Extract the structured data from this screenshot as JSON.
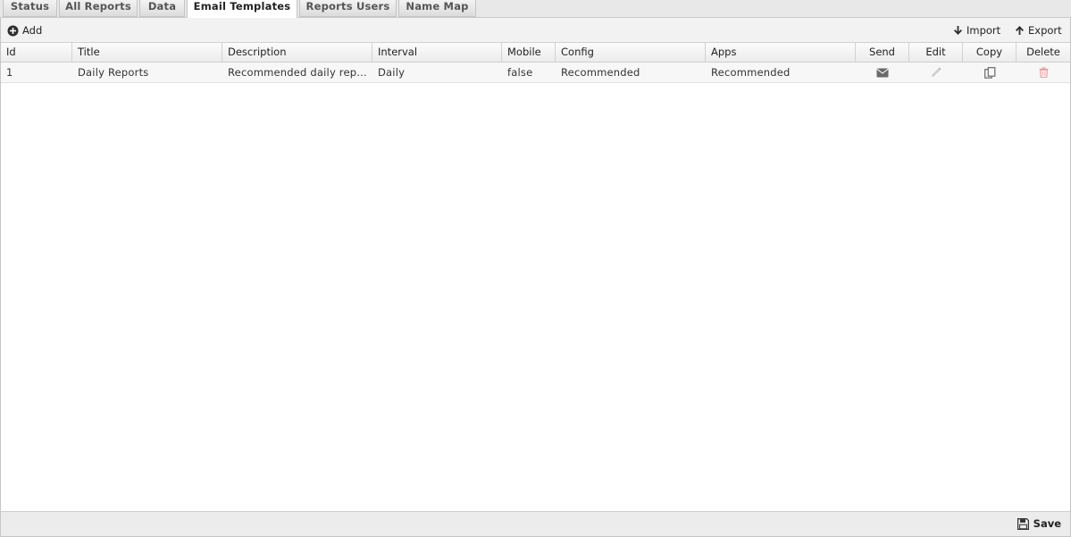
{
  "tabs": [
    {
      "label": "Status"
    },
    {
      "label": "All Reports"
    },
    {
      "label": "Data"
    },
    {
      "label": "Email Templates",
      "active": true
    },
    {
      "label": "Reports Users"
    },
    {
      "label": "Name Map"
    }
  ],
  "toolbar": {
    "add_label": "Add",
    "import_label": "Import",
    "export_label": "Export"
  },
  "table": {
    "columns": [
      "Id",
      "Title",
      "Description",
      "Interval",
      "Mobile",
      "Config",
      "Apps",
      "Send",
      "Edit",
      "Copy",
      "Delete"
    ],
    "rows": [
      {
        "id": "1",
        "title": "Daily Reports",
        "description": "Recommended daily repo...",
        "interval": "Daily",
        "mobile": "false",
        "config": "Recommended",
        "apps": "Recommended",
        "send_icon": "envelope-icon",
        "edit_icon": "pencil-icon",
        "copy_icon": "copy-icon",
        "delete_icon": "trash-icon"
      }
    ]
  },
  "footer": {
    "save_label": "Save"
  },
  "colors": {
    "delete_icon": "#f0a0a0",
    "send_icon": "#6a6a6a",
    "edit_icon": "#c8c8c8"
  }
}
